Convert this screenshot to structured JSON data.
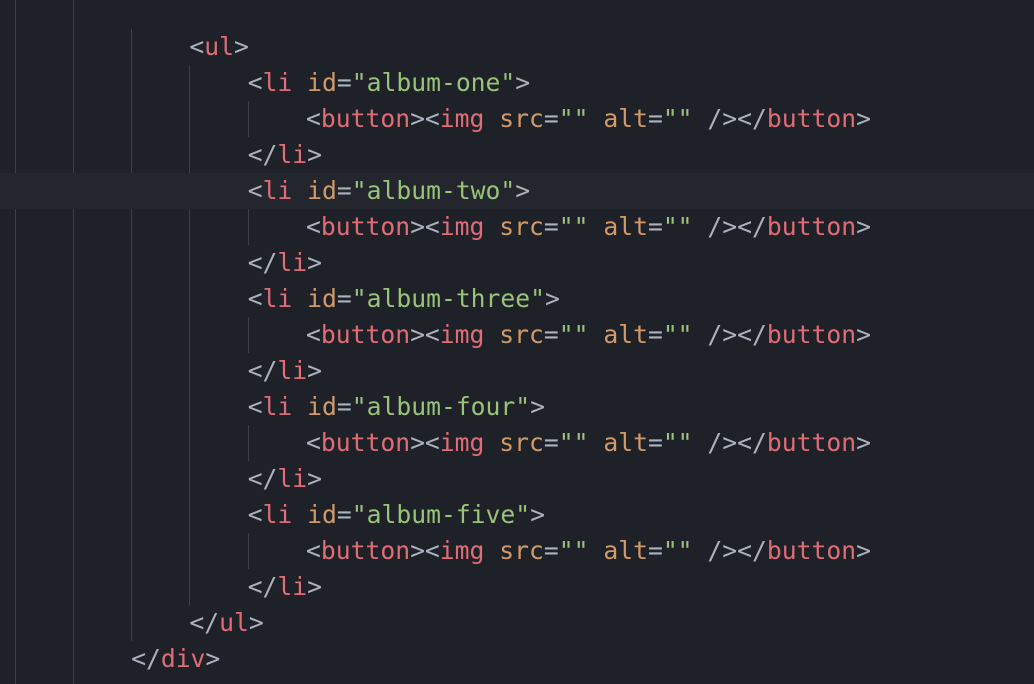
{
  "editor": {
    "colors": {
      "background": "#1f2128",
      "cursor_line": "#23262d",
      "punctuation": "#abb2bf",
      "tag": "#e06c75",
      "attribute": "#d19a66",
      "string": "#98c379",
      "indent_guide": "#3b3f48"
    },
    "lines": [
      {
        "indent": 3,
        "tokens": [
          [
            "punct",
            "<"
          ],
          [
            "tag",
            "ul"
          ],
          [
            "punct",
            ">"
          ]
        ]
      },
      {
        "indent": 4,
        "tokens": [
          [
            "punct",
            "<"
          ],
          [
            "tag",
            "li"
          ],
          [
            "punct",
            " "
          ],
          [
            "attr",
            "id"
          ],
          [
            "punct",
            "="
          ],
          [
            "str",
            "\"album-one\""
          ],
          [
            "punct",
            ">"
          ]
        ]
      },
      {
        "indent": 5,
        "tokens": [
          [
            "punct",
            "<"
          ],
          [
            "tag",
            "button"
          ],
          [
            "punct",
            "><"
          ],
          [
            "tag",
            "img"
          ],
          [
            "punct",
            " "
          ],
          [
            "attr",
            "src"
          ],
          [
            "punct",
            "="
          ],
          [
            "str",
            "\"\""
          ],
          [
            "punct",
            " "
          ],
          [
            "attr",
            "alt"
          ],
          [
            "punct",
            "="
          ],
          [
            "str",
            "\"\""
          ],
          [
            "punct",
            " /></"
          ],
          [
            "tag",
            "button"
          ],
          [
            "punct",
            ">"
          ]
        ]
      },
      {
        "indent": 4,
        "tokens": [
          [
            "punct",
            "</"
          ],
          [
            "tag",
            "li"
          ],
          [
            "punct",
            ">"
          ]
        ]
      },
      {
        "indent": 4,
        "cursor": true,
        "tokens": [
          [
            "punct",
            "<"
          ],
          [
            "tag",
            "li"
          ],
          [
            "punct",
            " "
          ],
          [
            "attr",
            "id"
          ],
          [
            "punct",
            "="
          ],
          [
            "str",
            "\"album-two\""
          ],
          [
            "punct",
            ">"
          ]
        ]
      },
      {
        "indent": 5,
        "tokens": [
          [
            "punct",
            "<"
          ],
          [
            "tag",
            "button"
          ],
          [
            "punct",
            "><"
          ],
          [
            "tag",
            "img"
          ],
          [
            "punct",
            " "
          ],
          [
            "attr",
            "src"
          ],
          [
            "punct",
            "="
          ],
          [
            "str",
            "\"\""
          ],
          [
            "punct",
            " "
          ],
          [
            "attr",
            "alt"
          ],
          [
            "punct",
            "="
          ],
          [
            "str",
            "\"\""
          ],
          [
            "punct",
            " /></"
          ],
          [
            "tag",
            "button"
          ],
          [
            "punct",
            ">"
          ]
        ]
      },
      {
        "indent": 4,
        "tokens": [
          [
            "punct",
            "</"
          ],
          [
            "tag",
            "li"
          ],
          [
            "punct",
            ">"
          ]
        ]
      },
      {
        "indent": 4,
        "tokens": [
          [
            "punct",
            "<"
          ],
          [
            "tag",
            "li"
          ],
          [
            "punct",
            " "
          ],
          [
            "attr",
            "id"
          ],
          [
            "punct",
            "="
          ],
          [
            "str",
            "\"album-three\""
          ],
          [
            "punct",
            ">"
          ]
        ]
      },
      {
        "indent": 5,
        "tokens": [
          [
            "punct",
            "<"
          ],
          [
            "tag",
            "button"
          ],
          [
            "punct",
            "><"
          ],
          [
            "tag",
            "img"
          ],
          [
            "punct",
            " "
          ],
          [
            "attr",
            "src"
          ],
          [
            "punct",
            "="
          ],
          [
            "str",
            "\"\""
          ],
          [
            "punct",
            " "
          ],
          [
            "attr",
            "alt"
          ],
          [
            "punct",
            "="
          ],
          [
            "str",
            "\"\""
          ],
          [
            "punct",
            " /></"
          ],
          [
            "tag",
            "button"
          ],
          [
            "punct",
            ">"
          ]
        ]
      },
      {
        "indent": 4,
        "tokens": [
          [
            "punct",
            "</"
          ],
          [
            "tag",
            "li"
          ],
          [
            "punct",
            ">"
          ]
        ]
      },
      {
        "indent": 4,
        "tokens": [
          [
            "punct",
            "<"
          ],
          [
            "tag",
            "li"
          ],
          [
            "punct",
            " "
          ],
          [
            "attr",
            "id"
          ],
          [
            "punct",
            "="
          ],
          [
            "str",
            "\"album-four\""
          ],
          [
            "punct",
            ">"
          ]
        ]
      },
      {
        "indent": 5,
        "tokens": [
          [
            "punct",
            "<"
          ],
          [
            "tag",
            "button"
          ],
          [
            "punct",
            "><"
          ],
          [
            "tag",
            "img"
          ],
          [
            "punct",
            " "
          ],
          [
            "attr",
            "src"
          ],
          [
            "punct",
            "="
          ],
          [
            "str",
            "\"\""
          ],
          [
            "punct",
            " "
          ],
          [
            "attr",
            "alt"
          ],
          [
            "punct",
            "="
          ],
          [
            "str",
            "\"\""
          ],
          [
            "punct",
            " /></"
          ],
          [
            "tag",
            "button"
          ],
          [
            "punct",
            ">"
          ]
        ]
      },
      {
        "indent": 4,
        "tokens": [
          [
            "punct",
            "</"
          ],
          [
            "tag",
            "li"
          ],
          [
            "punct",
            ">"
          ]
        ]
      },
      {
        "indent": 4,
        "tokens": [
          [
            "punct",
            "<"
          ],
          [
            "tag",
            "li"
          ],
          [
            "punct",
            " "
          ],
          [
            "attr",
            "id"
          ],
          [
            "punct",
            "="
          ],
          [
            "str",
            "\"album-five\""
          ],
          [
            "punct",
            ">"
          ]
        ]
      },
      {
        "indent": 5,
        "tokens": [
          [
            "punct",
            "<"
          ],
          [
            "tag",
            "button"
          ],
          [
            "punct",
            "><"
          ],
          [
            "tag",
            "img"
          ],
          [
            "punct",
            " "
          ],
          [
            "attr",
            "src"
          ],
          [
            "punct",
            "="
          ],
          [
            "str",
            "\"\""
          ],
          [
            "punct",
            " "
          ],
          [
            "attr",
            "alt"
          ],
          [
            "punct",
            "="
          ],
          [
            "str",
            "\"\""
          ],
          [
            "punct",
            " /></"
          ],
          [
            "tag",
            "button"
          ],
          [
            "punct",
            ">"
          ]
        ]
      },
      {
        "indent": 4,
        "tokens": [
          [
            "punct",
            "</"
          ],
          [
            "tag",
            "li"
          ],
          [
            "punct",
            ">"
          ]
        ]
      },
      {
        "indent": 3,
        "tokens": [
          [
            "punct",
            "</"
          ],
          [
            "tag",
            "ul"
          ],
          [
            "punct",
            ">"
          ]
        ]
      },
      {
        "indent": 2,
        "tokens": [
          [
            "punct",
            "</"
          ],
          [
            "tag",
            "div"
          ],
          [
            "punct",
            ">"
          ]
        ]
      }
    ]
  }
}
